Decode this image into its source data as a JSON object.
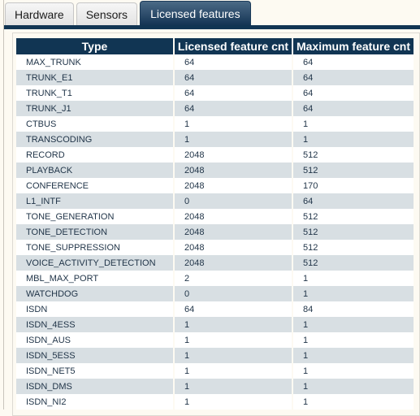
{
  "tabs": [
    {
      "label": "Hardware",
      "active": false
    },
    {
      "label": "Sensors",
      "active": false
    },
    {
      "label": "Licensed features",
      "active": true
    }
  ],
  "table": {
    "headers": [
      "Type",
      "Licensed feature cnt",
      "Maximum feature cnt"
    ],
    "rows": [
      {
        "type": "MAX_TRUNK",
        "licensed": "64",
        "maximum": "64"
      },
      {
        "type": "TRUNK_E1",
        "licensed": "64",
        "maximum": "64"
      },
      {
        "type": "TRUNK_T1",
        "licensed": "64",
        "maximum": "64"
      },
      {
        "type": "TRUNK_J1",
        "licensed": "64",
        "maximum": "64"
      },
      {
        "type": "CTBUS",
        "licensed": "1",
        "maximum": "1"
      },
      {
        "type": "TRANSCODING",
        "licensed": "1",
        "maximum": "1"
      },
      {
        "type": "RECORD",
        "licensed": "2048",
        "maximum": "512"
      },
      {
        "type": "PLAYBACK",
        "licensed": "2048",
        "maximum": "512"
      },
      {
        "type": "CONFERENCE",
        "licensed": "2048",
        "maximum": "170"
      },
      {
        "type": "L1_INTF",
        "licensed": "0",
        "maximum": "64"
      },
      {
        "type": "TONE_GENERATION",
        "licensed": "2048",
        "maximum": "512"
      },
      {
        "type": "TONE_DETECTION",
        "licensed": "2048",
        "maximum": "512"
      },
      {
        "type": "TONE_SUPPRESSION",
        "licensed": "2048",
        "maximum": "512"
      },
      {
        "type": "VOICE_ACTIVITY_DETECTION",
        "licensed": "2048",
        "maximum": "512"
      },
      {
        "type": "MBL_MAX_PORT",
        "licensed": "2",
        "maximum": "1"
      },
      {
        "type": "WATCHDOG",
        "licensed": "0",
        "maximum": "1"
      },
      {
        "type": "ISDN",
        "licensed": "64",
        "maximum": "84"
      },
      {
        "type": "ISDN_4ESS",
        "licensed": "1",
        "maximum": "1"
      },
      {
        "type": "ISDN_AUS",
        "licensed": "1",
        "maximum": "1"
      },
      {
        "type": "ISDN_5ESS",
        "licensed": "1",
        "maximum": "1"
      },
      {
        "type": "ISDN_NET5",
        "licensed": "1",
        "maximum": "1"
      },
      {
        "type": "ISDN_DMS",
        "licensed": "1",
        "maximum": "1"
      },
      {
        "type": "ISDN_NI2",
        "licensed": "1",
        "maximum": "1"
      }
    ]
  },
  "colors": {
    "accent": "#113553",
    "row_alt": "#d8dfe3",
    "page_bg": "#fdfaf2"
  }
}
